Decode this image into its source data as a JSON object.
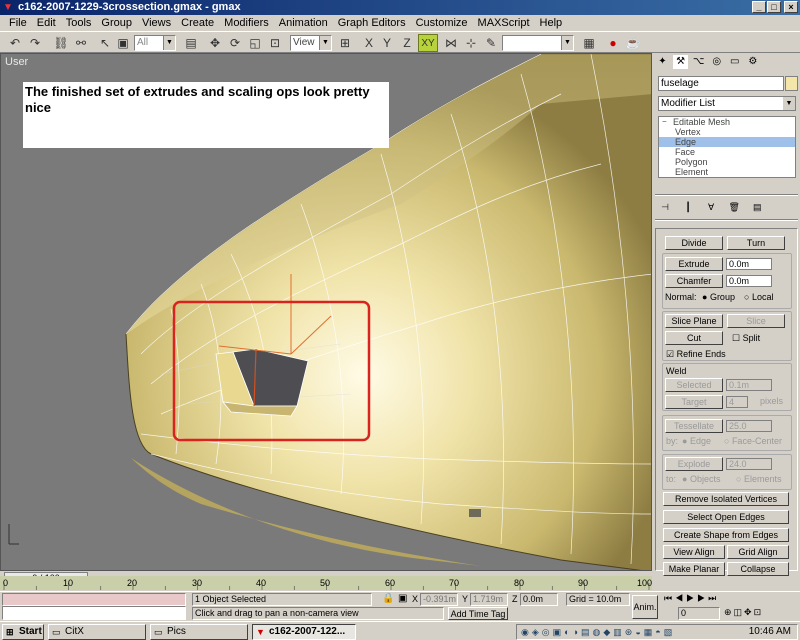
{
  "window": {
    "title": "c162-2007-1229-3crossection.gmax - gmax"
  },
  "menu": [
    "File",
    "Edit",
    "Tools",
    "Group",
    "Views",
    "Create",
    "Modifiers",
    "Animation",
    "Graph Editors",
    "Customize",
    "MAXScript",
    "Help"
  ],
  "toolbar": {
    "selection_filter": "All",
    "ref_coord": "View",
    "axis_constraint": "XY",
    "named_sets": ""
  },
  "viewport": {
    "label": "User",
    "note": "The finished set of extrudes and scaling ops look pretty nice"
  },
  "command_panel": {
    "object_name": "fuselage",
    "modifier_list": "Modifier List",
    "stack": {
      "root": "Editable Mesh",
      "items": [
        "Vertex",
        "Edge",
        "Face",
        "Polygon",
        "Element"
      ],
      "selected": "Edge"
    },
    "buttons": {
      "divide": "Divide",
      "turn": "Turn",
      "extrude": "Extrude",
      "chamfer": "Chamfer",
      "slice_plane": "Slice Plane",
      "slice": "Slice",
      "cut": "Cut",
      "selected": "Selected",
      "target": "Target",
      "tessellate": "Tessellate",
      "explode": "Explode",
      "remove_isolated": "Remove Isolated Vertices",
      "select_open_edges": "Select Open Edges",
      "create_shape": "Create Shape from Edges",
      "view_align": "View Align",
      "grid_align": "Grid Align",
      "make_planar": "Make Planar",
      "collapse": "Collapse"
    },
    "values": {
      "extrude": "0.0m",
      "chamfer": "0.0m",
      "weld_selected": "0.1m",
      "weld_target": "4",
      "tessellate": "25.0",
      "explode": "24.0"
    },
    "labels": {
      "normal": "Normal:",
      "group": "Group",
      "local": "Local",
      "split": "Split",
      "refine_ends": "Refine Ends",
      "weld": "Weld",
      "pixels": "pixels",
      "by": "by:",
      "edge": "Edge",
      "face_center": "Face-Center",
      "to": "to:",
      "objects": "Objects",
      "elements": "Elements"
    }
  },
  "timeline": {
    "slider": "0 / 100",
    "ticks": [
      "0",
      "10",
      "20",
      "30",
      "40",
      "50",
      "60",
      "70",
      "80",
      "90",
      "100"
    ]
  },
  "status": {
    "selection": "1 Object Selected",
    "prompt": "Click and drag to pan a non-camera view",
    "x_label": "X",
    "x": "-0.391m",
    "y_label": "Y",
    "y": "1.719m",
    "z_label": "Z",
    "z": "0.0m",
    "grid": "Grid = 10.0m",
    "add_time_tag": "Add Time Tag",
    "anim": "Anim.",
    "frame": "0"
  },
  "taskbar": {
    "start": "Start",
    "items": [
      "CitX",
      "Pics",
      "c162-2007-122..."
    ],
    "clock": "10:46 AM"
  }
}
